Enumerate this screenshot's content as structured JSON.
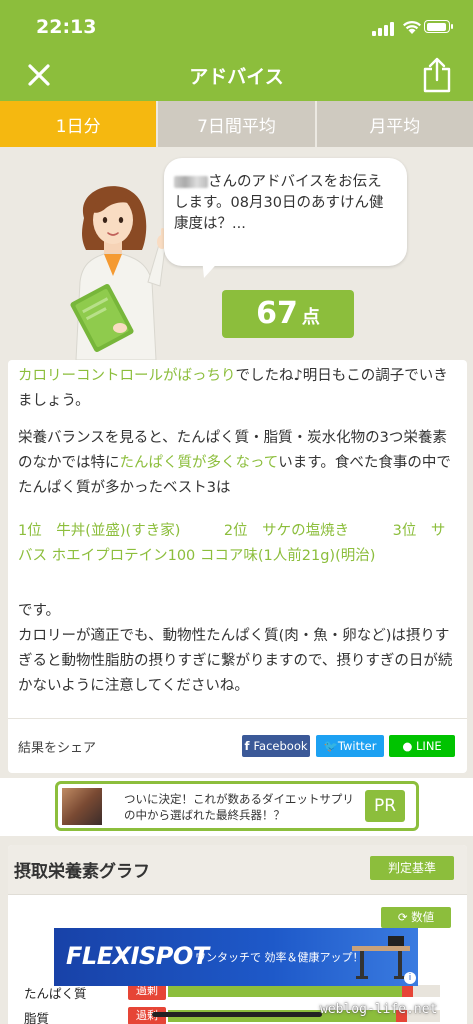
{
  "status": {
    "time": "22:13"
  },
  "header": {
    "title": "アドバイス"
  },
  "tabs": [
    {
      "label": "1日分",
      "active": true
    },
    {
      "label": "7日間平均",
      "active": false
    },
    {
      "label": "月平均",
      "active": false
    }
  ],
  "advice": {
    "bubble_text": "さんのアドバイスをお伝えします。08月30日のあすけん健康度は？...",
    "score": "67",
    "score_unit": "点"
  },
  "message": {
    "p1_highlight": "カロリーコントロールがばっちり",
    "p1_rest": "でしたね♪明日もこの調子でいきましょう。",
    "p2_pre": "栄養バランスを見ると、たんぱく質・脂質・炭水化物の3つ栄養素のなかでは特に",
    "p2_highlight": "たんぱく質が多くなって",
    "p2_post": "います。食べた食事の中でたんぱく質が多かったベスト3は",
    "rank_1": "1位　牛丼(並盛)(すき家)",
    "rank_2": "2位　サケの塩焼き",
    "rank_3": "3位　サバス ホエイプロテイン100 ココア味(1人前21g)(明治)",
    "p3": "です。",
    "p4": "カロリーが適正でも、動物性たんぱく質(肉・魚・卵など)は摂りすぎると動物性脂肪の摂りすぎに繋がりますので、摂りすぎの日が続かないように注意してくださいね。"
  },
  "share": {
    "label": "結果をシェア",
    "facebook": "Facebook",
    "twitter": "Twitter",
    "line": "LINE"
  },
  "pr_banner": {
    "text": "ついに決定！これが数あるダイエットサプリの中から選ばれた最終兵器！？",
    "badge": "PR"
  },
  "graph": {
    "title": "摂取栄養素グラフ",
    "judge_button": "判定基準",
    "value_button": "数値",
    "rows": [
      {
        "label": "たんぱく質",
        "status": "過剰",
        "fill": 0.86
      },
      {
        "label": "脂質",
        "status": "過剰",
        "fill": 0.84
      }
    ]
  },
  "ad": {
    "brand": "FLEXISPOT",
    "copy": "ワンタッチで  効率＆健康アップ！"
  },
  "watermark": "weblog-life.net",
  "colors": {
    "primary": "#8cbe3c",
    "active_tab": "#f5b810",
    "excess": "#e64536",
    "facebook": "#3b5998",
    "twitter": "#1da1f2",
    "line": "#00c300"
  }
}
